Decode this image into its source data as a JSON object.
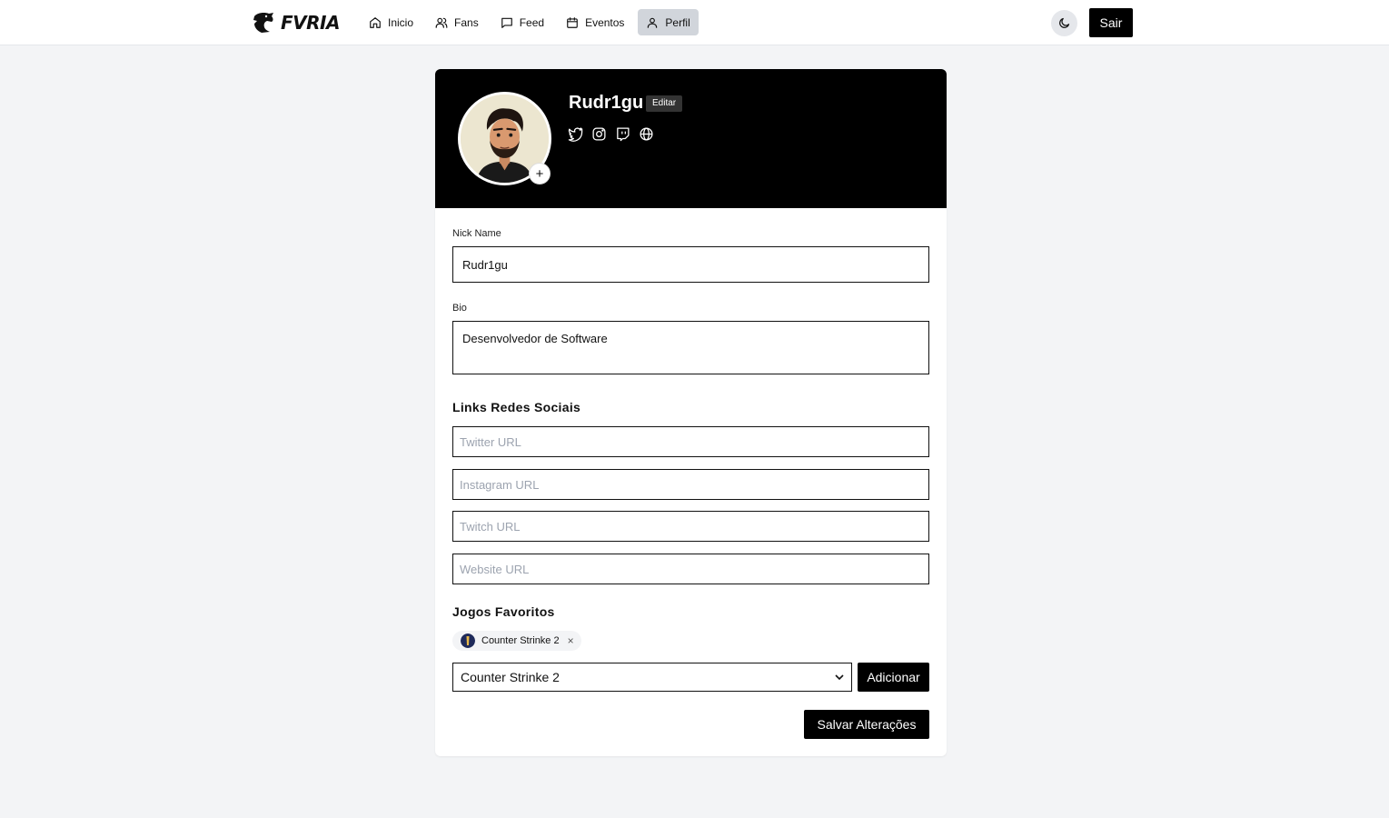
{
  "brand": {
    "name": "FVRIA"
  },
  "nav": {
    "items": [
      {
        "label": "Inicio",
        "icon": "home-icon"
      },
      {
        "label": "Fans",
        "icon": "users-icon"
      },
      {
        "label": "Feed",
        "icon": "message-icon"
      },
      {
        "label": "Eventos",
        "icon": "calendar-icon"
      },
      {
        "label": "Perfil",
        "icon": "user-icon",
        "active": true
      }
    ],
    "theme_icon": "moon-icon",
    "logout_label": "Sair"
  },
  "profile": {
    "username": "Rudr1gu",
    "edit_label": "Editar",
    "avatar_add": "+",
    "social_icons": [
      "twitter-icon",
      "instagram-icon",
      "twitch-icon",
      "globe-icon"
    ]
  },
  "form": {
    "nick_label": "Nick Name",
    "nick_value": "Rudr1gu",
    "bio_label": "Bio",
    "bio_value": "Desenvolvedor de Software",
    "social_section_title": "Links Redes Sociais",
    "twitter_placeholder": "Twitter URL",
    "instagram_placeholder": "Instagram URL",
    "twitch_placeholder": "Twitch URL",
    "website_placeholder": "Website URL",
    "games_section_title": "Jogos Favoritos",
    "favorite_games": [
      "Counter Strinke 2"
    ],
    "chip_remove": "×",
    "select_value": "Counter Strinke 2",
    "add_label": "Adicionar",
    "save_label": "Salvar Alterações"
  },
  "colors": {
    "header_bg": "#000000",
    "page_bg": "#f3f4f6",
    "active_nav_bg": "#d1d5db"
  }
}
